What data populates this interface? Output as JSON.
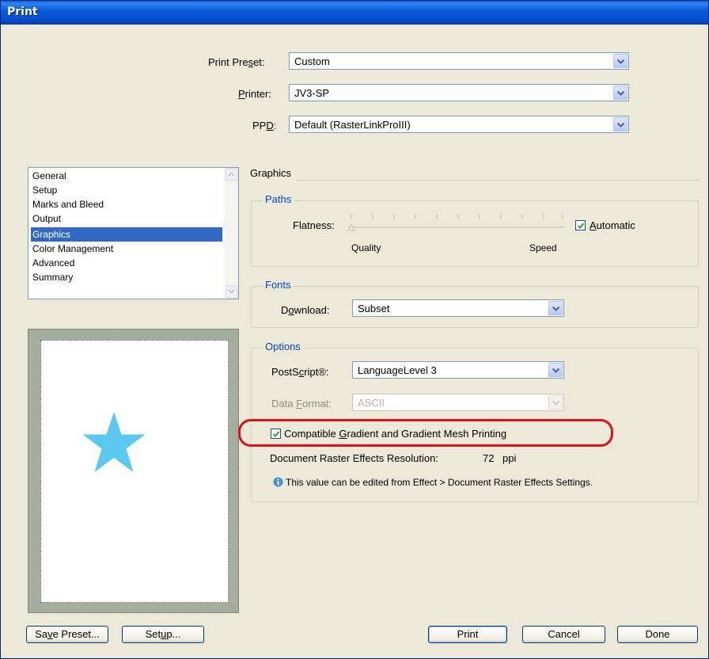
{
  "window": {
    "title": "Print"
  },
  "top": {
    "preset_label": "Print Preset:",
    "preset_value": "Custom",
    "printer_label": "Printer:",
    "printer_value": "JV3-SP",
    "ppd_label": "PPD:",
    "ppd_value": "Default (RasterLinkProIII)"
  },
  "sidebar": {
    "items": [
      {
        "label": "General"
      },
      {
        "label": "Setup"
      },
      {
        "label": "Marks and Bleed"
      },
      {
        "label": "Output"
      },
      {
        "label": "Graphics",
        "selected": true
      },
      {
        "label": "Color Management"
      },
      {
        "label": "Advanced"
      },
      {
        "label": "Summary"
      }
    ]
  },
  "panel": {
    "heading": "Graphics",
    "paths": {
      "title": "Paths",
      "flatness_label": "Flatness:",
      "quality_label": "Quality",
      "speed_label": "Speed",
      "automatic_label": "Automatic",
      "automatic_checked": true
    },
    "fonts": {
      "title": "Fonts",
      "download_label": "Download:",
      "download_value": "Subset"
    },
    "options": {
      "title": "Options",
      "postscript_label": "PostScript®:",
      "postscript_value": "LanguageLevel 3",
      "data_format_label": "Data Format:",
      "data_format_value": "ASCII",
      "compatible_label": "Compatible Gradient and Gradient Mesh Printing",
      "compatible_checked": true,
      "raster_label": "Document Raster Effects Resolution:",
      "raster_value": "72",
      "raster_unit": "ppi",
      "info_text": "This value can be edited from Effect > Document Raster Effects Settings."
    }
  },
  "buttons": {
    "save_preset": "Save Preset...",
    "setup": "Setup...",
    "print": "Print",
    "cancel": "Cancel",
    "done": "Done"
  },
  "colors": {
    "titlebar": "#0a5ad8",
    "selection": "#316ac5",
    "group_title": "#0046d5",
    "highlight_ring": "#e0101a",
    "star": "#5bc8ef"
  },
  "icons": {
    "dropdown": "chevron-down-icon",
    "check": "check-icon",
    "info": "info-icon",
    "star": "star-icon"
  }
}
